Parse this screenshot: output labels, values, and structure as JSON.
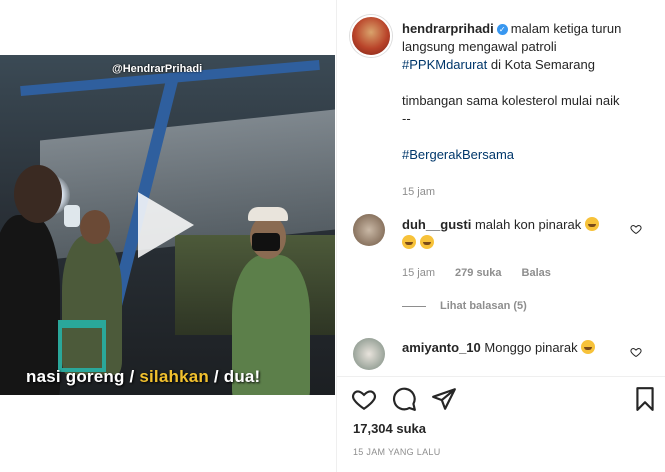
{
  "video": {
    "watermark": "@HendrarPrihadi",
    "caption_white_1": "nasi goreng / ",
    "caption_highlight": "silahkan",
    "caption_white_2": " / dua!"
  },
  "post": {
    "username": "hendrarprihadi",
    "line1": "malam ketiga turun",
    "line2": "langsung mengawal patroli",
    "hashtag1": "#PPKMdarurat",
    "line3_rest": " di Kota Semarang",
    "line4": "timbangan sama kolesterol mulai naik",
    "line5": "--",
    "hashtag2": "#BergerakBersama",
    "age": "15 jam"
  },
  "comments": [
    {
      "username": "duh__gusti",
      "text": "malah kon pinarak",
      "age": "15 jam",
      "likes": "279 suka",
      "reply": "Balas",
      "view_replies": "Lihat balasan (5)"
    },
    {
      "username": "amiyanto_10",
      "text": "Monggo pinarak"
    }
  ],
  "footer": {
    "likes": "17,304 suka",
    "timestamp": "15 JAM YANG LALU"
  },
  "colors": {
    "link": "#00376b",
    "verified": "#3897f0",
    "caption_highlight": "#f2c12e"
  }
}
